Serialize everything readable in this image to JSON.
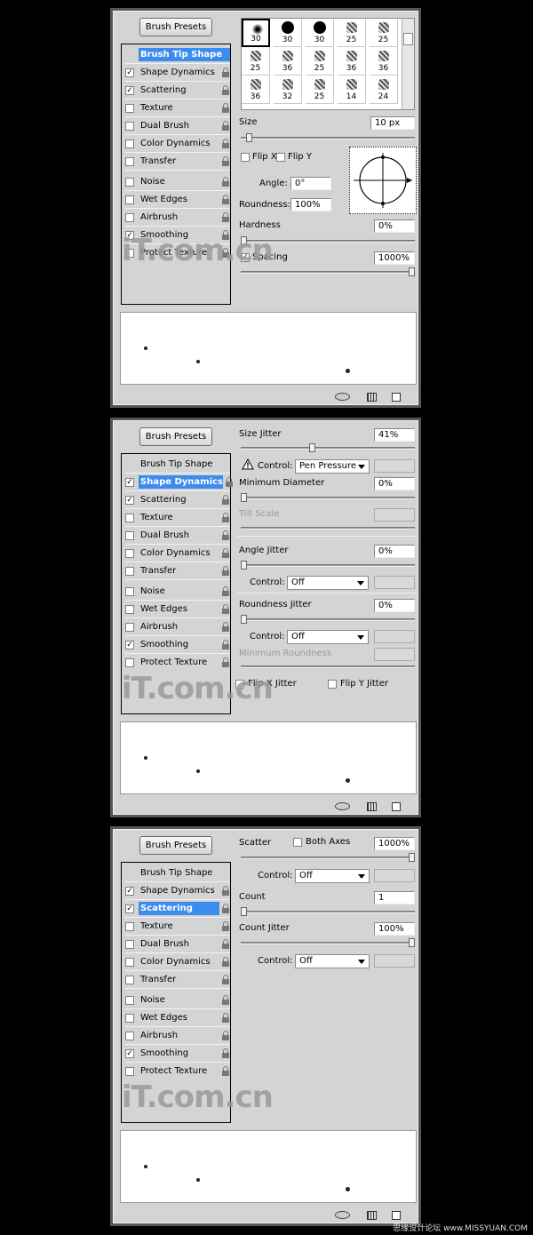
{
  "brush_presets_label": "Brush Presets",
  "options": [
    {
      "label": "Brush Tip Shape",
      "has_checkbox": false
    },
    {
      "label": "Shape Dynamics",
      "has_checkbox": true
    },
    {
      "label": "Scattering",
      "has_checkbox": true
    },
    {
      "label": "Texture",
      "has_checkbox": true
    },
    {
      "label": "Dual Brush",
      "has_checkbox": true
    },
    {
      "label": "Color Dynamics",
      "has_checkbox": true
    },
    {
      "label": "Transfer",
      "has_checkbox": true
    },
    {
      "label": "Noise",
      "has_checkbox": true
    },
    {
      "label": "Wet Edges",
      "has_checkbox": true
    },
    {
      "label": "Airbrush",
      "has_checkbox": true
    },
    {
      "label": "Smoothing",
      "has_checkbox": true
    },
    {
      "label": "Protect Texture",
      "has_checkbox": true
    }
  ],
  "panel1": {
    "checked": [
      1,
      2,
      10
    ],
    "selected": 0,
    "tip_sizes": [
      "30",
      "30",
      "30",
      "25",
      "25",
      "25",
      "36",
      "25",
      "36",
      "36",
      "36",
      "32",
      "25",
      "14",
      "24"
    ],
    "size_label": "Size",
    "size_value": "10 px",
    "size_slider": 0.03,
    "flip_x_label": "Flip X",
    "flip_y_label": "Flip Y",
    "angle_label": "Angle:",
    "angle_value": "0°",
    "roundness_label": "Roundness:",
    "roundness_value": "100%",
    "hardness_label": "Hardness",
    "hardness_value": "0%",
    "hardness_slider": 0.0,
    "spacing_label": "Spacing",
    "spacing_value": "1000%",
    "spacing_slider": 1.0
  },
  "panel2": {
    "checked": [
      1,
      2,
      10
    ],
    "selected": 1,
    "size_jitter_label": "Size Jitter",
    "size_jitter_value": "41%",
    "size_jitter_slider": 0.41,
    "control_label": "Control:",
    "control_pen_value": "Pen Pressure",
    "min_diameter_label": "Minimum Diameter",
    "min_diameter_value": "0%",
    "tilt_scale_label": "Tilt Scale",
    "angle_jitter_label": "Angle Jitter",
    "angle_jitter_value": "0%",
    "control_off": "Off",
    "roundness_jitter_label": "Roundness Jitter",
    "roundness_jitter_value": "0%",
    "min_roundness_label": "Minimum Roundness",
    "flip_x_jitter_label": "Flip X Jitter",
    "flip_y_jitter_label": "Flip Y Jitter"
  },
  "panel3": {
    "checked": [
      1,
      2,
      10
    ],
    "selected": 2,
    "scatter_label": "Scatter",
    "both_axes_label": "Both Axes",
    "scatter_value": "1000%",
    "scatter_slider": 1.0,
    "control_label": "Control:",
    "control_off": "Off",
    "count_label": "Count",
    "count_value": "1",
    "count_slider": 0.0,
    "count_jitter_label": "Count Jitter",
    "count_jitter_value": "100%",
    "count_jitter_slider": 1.0
  },
  "watermark": "iT.com.cn",
  "site_label": "思缘设计论坛 www.MISSYUAN.COM",
  "colors": {
    "selection": "#3b8ced",
    "panel": "#d4d4d4"
  }
}
